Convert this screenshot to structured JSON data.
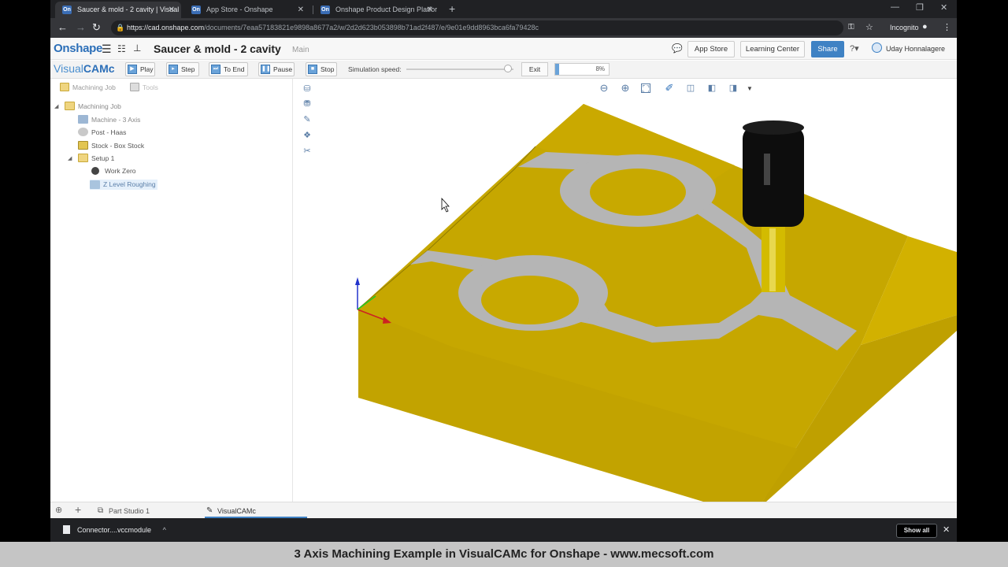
{
  "browser": {
    "tabs": [
      {
        "title": "Saucer & mold - 2 cavity | Visual",
        "favicon": "On"
      },
      {
        "title": "App Store - Onshape",
        "favicon": "On"
      },
      {
        "title": "Onshape Product Design Platfor",
        "favicon": "On"
      }
    ],
    "url_host": "https://cad.onshape.com",
    "url_path": "/documents/7eaa57183821e9898a8677a2/w/2d2d623b053898b71ad2f487/e/9e01e9dd8963bca6fa79428c",
    "profile": "Incognito"
  },
  "onshape": {
    "logo": "Onshape",
    "doc_title": "Saucer & mold - 2 cavity",
    "workspace": "Main",
    "app_store": "App Store",
    "learning_center": "Learning Center",
    "share": "Share",
    "user": "Uday Honnalagere"
  },
  "visualcam": {
    "logo_light": "Visual",
    "logo_bold": "CAMc",
    "buttons": {
      "play": "Play",
      "step": "Step",
      "to_end": "To End",
      "pause": "Pause",
      "stop": "Stop"
    },
    "sim_label": "Simulation speed:",
    "sim_speed": 0.95,
    "exit": "Exit",
    "progress_text": "8%",
    "progress": 0.08
  },
  "sidebar": {
    "tabs": [
      "Machining Job",
      "Tools"
    ],
    "tree": [
      {
        "label": "Machining Job",
        "level": 0,
        "icon": "folder-icon"
      },
      {
        "label": "Machine - 3 Axis",
        "level": 1,
        "icon": "machine-icon"
      },
      {
        "label": "Post - Haas",
        "level": 1,
        "icon": "post-icon"
      },
      {
        "label": "Stock - Box Stock",
        "level": 1,
        "icon": "stock-icon"
      },
      {
        "label": "Setup 1",
        "level": 1,
        "icon": "setup-icon"
      },
      {
        "label": "Work Zero",
        "level": 2,
        "icon": "work-zero-icon"
      },
      {
        "label": "Z Level Roughing",
        "level": 2,
        "icon": "roughing-icon",
        "selected": true
      }
    ]
  },
  "bottom_tabs": [
    "Part Studio 1",
    "VisualCAMc"
  ],
  "download": {
    "file": "Connector....vccmodule",
    "show_all": "Show all"
  },
  "caption": "3 Axis Machining Example in VisualCAMc for Onshape - www.mecsoft.com",
  "colors": {
    "accent": "#3f82c4",
    "stock": "#c9a800",
    "toolpath": "#b4b4b4",
    "tool": "#111111"
  }
}
